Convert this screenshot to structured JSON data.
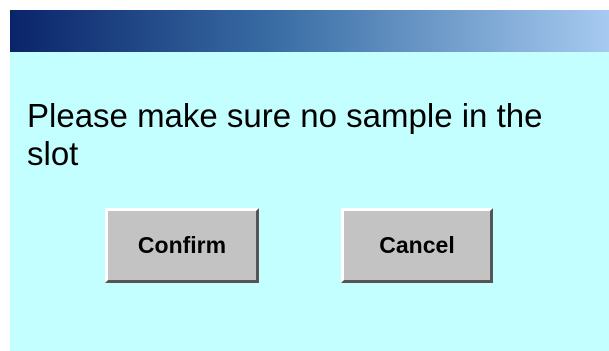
{
  "dialog": {
    "message": "Please make sure no sample in the slot",
    "confirm_label": "Confirm",
    "cancel_label": "Cancel"
  },
  "colors": {
    "titlebar_start": "#0a246a",
    "titlebar_end": "#a6caf0",
    "body_background": "#c4ffff",
    "button_face": "#c3c3c3"
  }
}
